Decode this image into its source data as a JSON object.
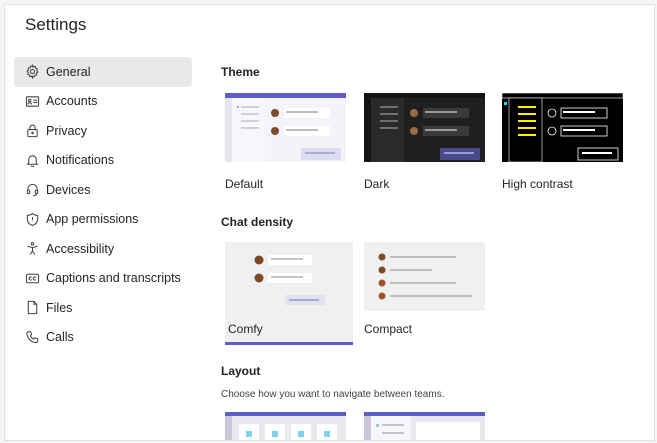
{
  "page": {
    "title": "Settings"
  },
  "sidebar": {
    "items": [
      {
        "label": "General",
        "icon": "gear-icon",
        "active": true
      },
      {
        "label": "Accounts",
        "icon": "id-card-icon",
        "active": false
      },
      {
        "label": "Privacy",
        "icon": "lock-icon",
        "active": false
      },
      {
        "label": "Notifications",
        "icon": "bell-icon",
        "active": false
      },
      {
        "label": "Devices",
        "icon": "headset-icon",
        "active": false
      },
      {
        "label": "App permissions",
        "icon": "shield-icon",
        "active": false
      },
      {
        "label": "Accessibility",
        "icon": "accessibility-icon",
        "active": false
      },
      {
        "label": "Captions and transcripts",
        "icon": "closed-captions-icon",
        "active": false
      },
      {
        "label": "Files",
        "icon": "file-icon",
        "active": false
      },
      {
        "label": "Calls",
        "icon": "phone-icon",
        "active": false
      }
    ]
  },
  "theme": {
    "title": "Theme",
    "options": [
      {
        "label": "Default"
      },
      {
        "label": "Dark"
      },
      {
        "label": "High contrast"
      }
    ]
  },
  "chat_density": {
    "title": "Chat density",
    "options": [
      {
        "label": "Comfy",
        "selected": true
      },
      {
        "label": "Compact",
        "selected": false
      }
    ]
  },
  "layout": {
    "title": "Layout",
    "description": "Choose how you want to navigate between teams."
  },
  "colors": {
    "accent": "#5b5fc7",
    "active_nav_bg": "#e9e9e9"
  }
}
